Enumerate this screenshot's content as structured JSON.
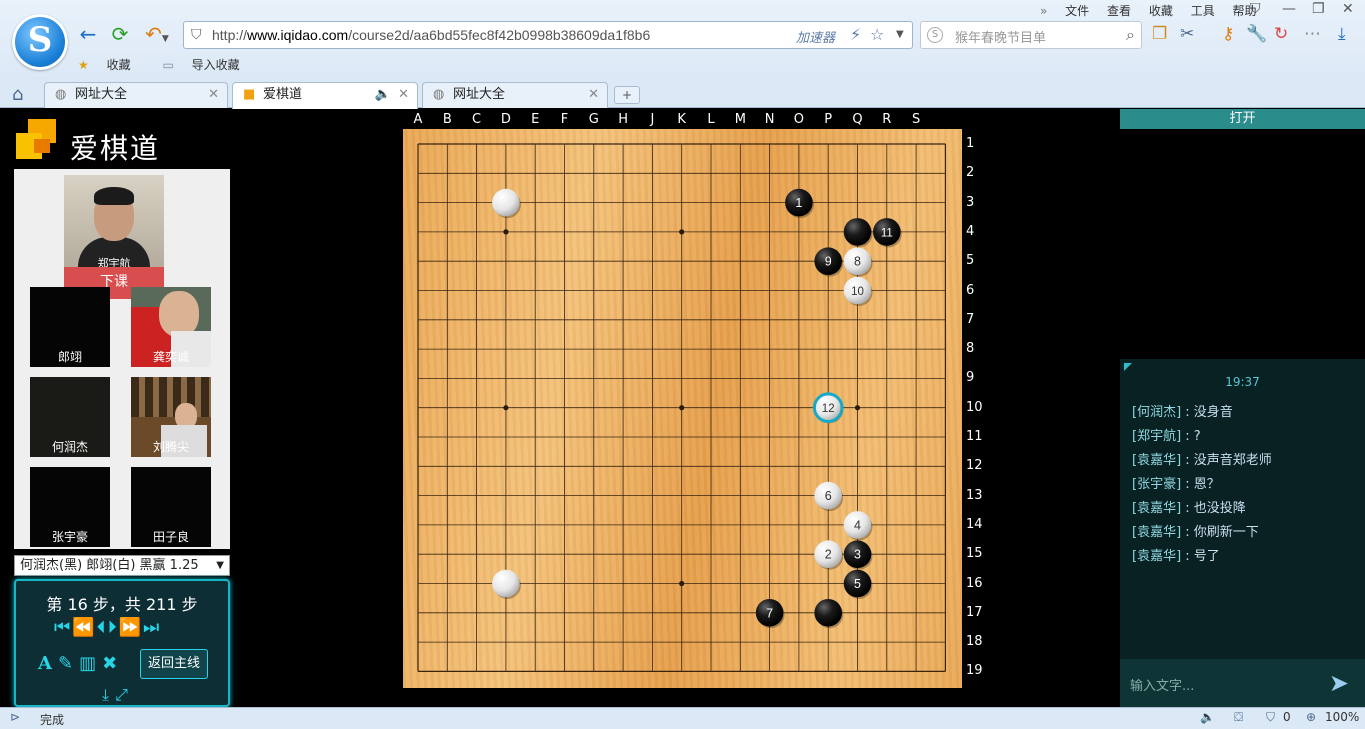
{
  "browser": {
    "url_prefix": "http://",
    "url_host": "www.iqidao.com",
    "url_path": "/course2d/aa6bd55fec8f42b0998b38609da1f8b6",
    "accelerator_label": "加速器",
    "search_placeholder": "猴年春晚节目单",
    "menu": [
      "文件",
      "查看",
      "收藏",
      "工具",
      "帮助"
    ],
    "favorites_label": "收藏",
    "import_favorites_label": "导入收藏",
    "tabs": [
      {
        "label": "网址大全",
        "active": false
      },
      {
        "label": "爱棋道",
        "active": true
      },
      {
        "label": "网址大全",
        "active": false
      }
    ],
    "status_text": "完成",
    "status_count": "0",
    "zoom": "100%"
  },
  "app": {
    "brand_name": "爱棋道",
    "teacher_name": "郑宇航",
    "end_class_label": "下课",
    "students": [
      "郎翊",
      "龚奕诚",
      "何润杰",
      "刘腾尖",
      "张宇豪",
      "田子良"
    ],
    "record_select": "何润杰(黑) 郎翊(白) 黑赢 1.25",
    "steps_text": "第 16 步，共 211 步",
    "back_main_label": "返回主线",
    "open_label": "打开"
  },
  "board": {
    "columns": [
      "A",
      "B",
      "C",
      "D",
      "E",
      "F",
      "G",
      "H",
      "J",
      "K",
      "L",
      "M",
      "N",
      "O",
      "P",
      "Q",
      "R",
      "S"
    ],
    "rows": [
      "1",
      "2",
      "3",
      "4",
      "5",
      "6",
      "7",
      "8",
      "9",
      "10",
      "11",
      "12",
      "13",
      "14",
      "15",
      "16",
      "17",
      "18",
      "19"
    ],
    "stones": [
      {
        "col": 14,
        "row": 3,
        "color": "black",
        "num": "1"
      },
      {
        "col": 15,
        "row": 15,
        "color": "white",
        "num": "2"
      },
      {
        "col": 16,
        "row": 15,
        "color": "black",
        "num": "3"
      },
      {
        "col": 16,
        "row": 14,
        "color": "white",
        "num": "4"
      },
      {
        "col": 16,
        "row": 16,
        "color": "black",
        "num": "5"
      },
      {
        "col": 15,
        "row": 13,
        "color": "white",
        "num": "6"
      },
      {
        "col": 13,
        "row": 17,
        "color": "black",
        "num": "7"
      },
      {
        "col": 16,
        "row": 5,
        "color": "white",
        "num": "8"
      },
      {
        "col": 15,
        "row": 5,
        "color": "black",
        "num": "9"
      },
      {
        "col": 16,
        "row": 6,
        "color": "white",
        "num": "10"
      },
      {
        "col": 17,
        "row": 4,
        "color": "black",
        "num": "11"
      },
      {
        "col": 15,
        "row": 10,
        "color": "white",
        "num": "12",
        "last": true
      },
      {
        "col": 4,
        "row": 3,
        "color": "white",
        "num": ""
      },
      {
        "col": 4,
        "row": 16,
        "color": "white",
        "num": ""
      },
      {
        "col": 16,
        "row": 4,
        "color": "black",
        "num": ""
      },
      {
        "col": 15,
        "row": 17,
        "color": "black",
        "num": ""
      }
    ],
    "star_points": [
      [
        4,
        4
      ],
      [
        10,
        4
      ],
      [
        16,
        4
      ],
      [
        4,
        10
      ],
      [
        10,
        10
      ],
      [
        16,
        10
      ],
      [
        4,
        16
      ],
      [
        10,
        16
      ],
      [
        16,
        16
      ]
    ]
  },
  "chat": {
    "time": "19:37",
    "messages": [
      {
        "who": "[何润杰]",
        "text": "没身音"
      },
      {
        "who": "[郑宇航]",
        "text": "?"
      },
      {
        "who": "[袁嘉华]",
        "text": "没声音郑老师"
      },
      {
        "who": "[张宇豪]",
        "text": "恩？"
      },
      {
        "who": "[袁嘉华]",
        "text": "也没投降"
      },
      {
        "who": "[袁嘉华]",
        "text": "你刷新一下"
      },
      {
        "who": "[袁嘉华]",
        "text": "号了"
      }
    ],
    "input_placeholder": "输入文字..."
  },
  "colors": {
    "accent": "#16b6c6",
    "end_class_bg": "#d84e4e",
    "panel_open_bg": "#2b8c8c"
  }
}
